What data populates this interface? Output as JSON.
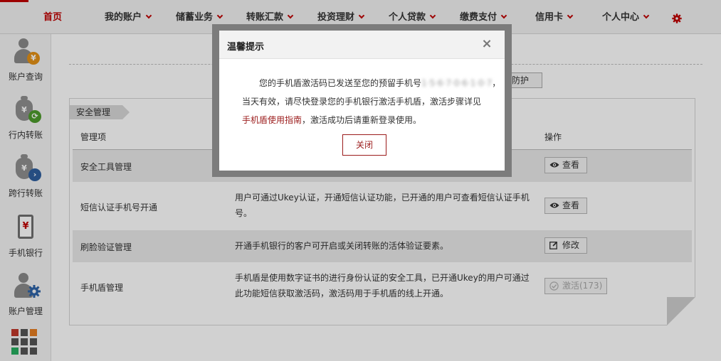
{
  "nav": {
    "items": [
      {
        "label": "首页",
        "active": true
      },
      {
        "label": "我的账户"
      },
      {
        "label": "储蓄业务"
      },
      {
        "label": "转账汇款"
      },
      {
        "label": "投资理财"
      },
      {
        "label": "个人贷款"
      },
      {
        "label": "缴费支付"
      },
      {
        "label": "信用卡"
      },
      {
        "label": "个人中心"
      }
    ],
    "settings_icon": "gear-icon",
    "accent_color": "#c00000"
  },
  "sidebar": {
    "items": [
      {
        "label": "账户查询",
        "icon": "user-yen-icon"
      },
      {
        "label": "行内转账",
        "icon": "money-bag-refresh-icon"
      },
      {
        "label": "跨行转账",
        "icon": "money-bag-arrow-icon"
      },
      {
        "label": "手机银行",
        "icon": "mobile-phone-icon"
      },
      {
        "label": "账户管理",
        "icon": "user-gear-icon"
      }
    ],
    "more_icon": "app-grid-icon"
  },
  "main": {
    "top_button_label": "防护",
    "section_tab": "安全管理",
    "table": {
      "headers": {
        "item": "管理项",
        "operation": "操作"
      },
      "rows": [
        {
          "name": "安全工具管理",
          "description": "",
          "action": "查看",
          "action_icon": "eye-icon"
        },
        {
          "name": "短信认证手机号开通",
          "description": "用户可通过Ukey认证，开通短信认证功能，已开通的用户可查看短信认证手机号。",
          "action": "查看",
          "action_icon": "eye-icon"
        },
        {
          "name": "刷脸验证管理",
          "description": "开通手机银行的客户可开启或关闭转账的活体验证要素。",
          "action": "修改",
          "action_icon": "edit-icon"
        },
        {
          "name": "手机盾管理",
          "description": "手机盾是使用数字证书的进行身份认证的安全工具，已开通Ukey的用户可通过此功能短信获取激活码，激活码用于手机盾的线上开通。",
          "action": "激活(173)",
          "action_icon": "check-circle-icon",
          "action_disabled": true
        }
      ]
    }
  },
  "dialog": {
    "title": "温馨提示",
    "close_symbol": "×",
    "line1_prefix": "您的手机盾激活码已发送至您的预留手机号",
    "line1_masked": "1·5·6·7·0·6·1·0·7",
    "line1_suffix": "，",
    "line2": "当天有效，请尽快登录您的手机银行激活手机盾，激活步骤详见",
    "line3_link": "手机盾使用指南",
    "line3_rest": "，激活成功后请重新登录使用。",
    "button_label": "关闭"
  }
}
